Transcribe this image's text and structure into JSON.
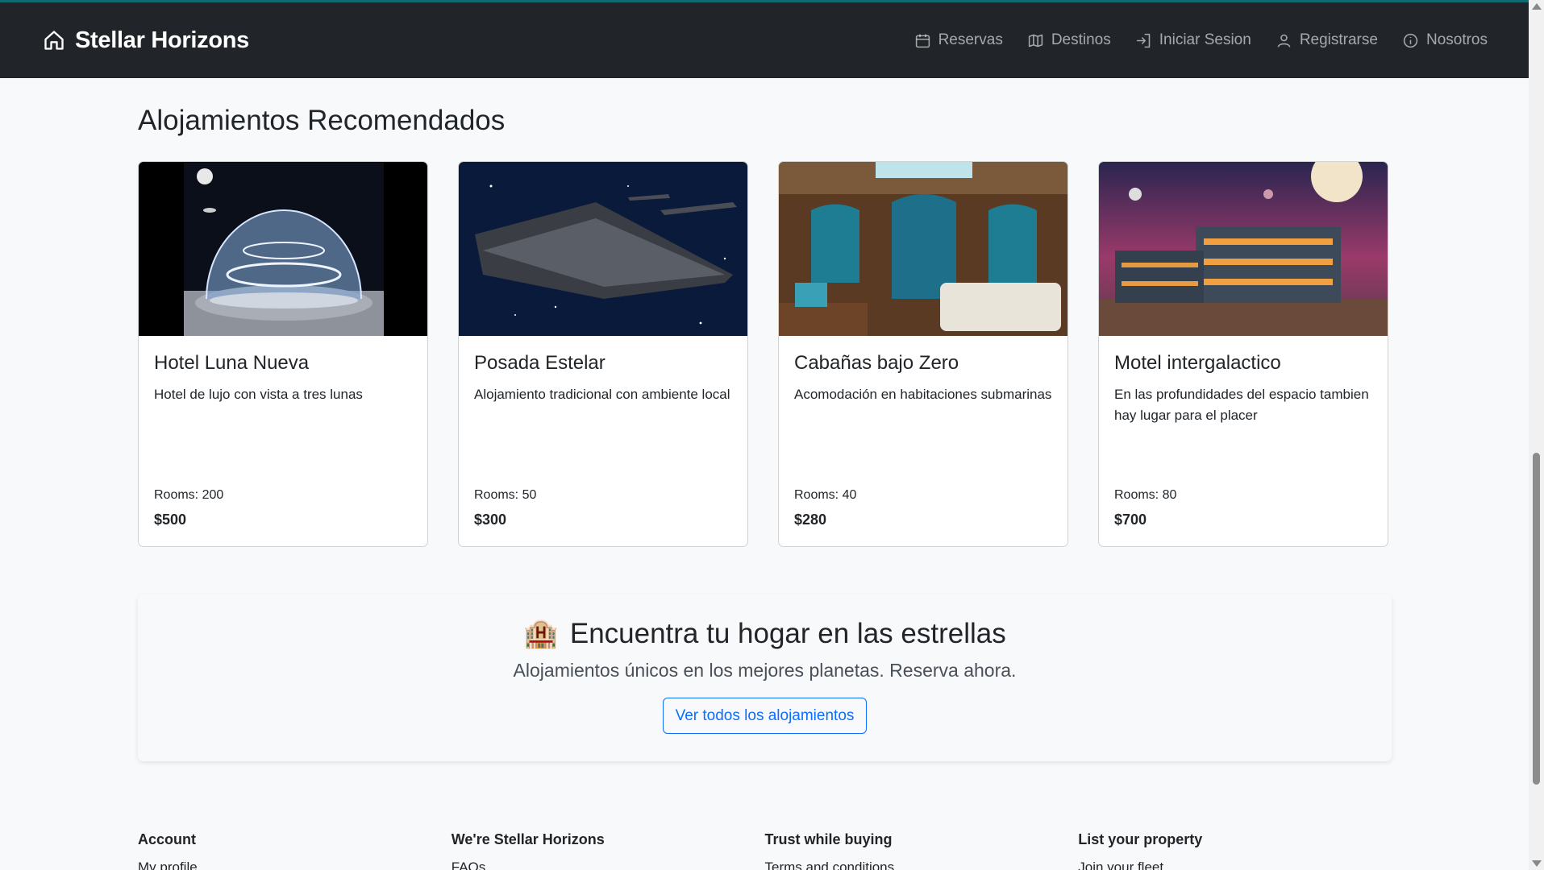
{
  "navbar": {
    "brand": "Stellar Horizons",
    "links": [
      {
        "label": "Reservas",
        "icon": "calendar-icon"
      },
      {
        "label": "Destinos",
        "icon": "map-icon"
      },
      {
        "label": "Iniciar Sesion",
        "icon": "login-icon"
      },
      {
        "label": "Registrarse",
        "icon": "user-icon"
      },
      {
        "label": "Nosotros",
        "icon": "info-icon"
      }
    ]
  },
  "section": {
    "title": "Alojamientos Recomendados"
  },
  "cards": [
    {
      "title": "Hotel Luna Nueva",
      "description": "Hotel de lujo con vista a tres lunas",
      "rooms": "Rooms: 200",
      "price": "$500",
      "image": "moon-dome-hotel"
    },
    {
      "title": "Posada Estelar",
      "description": "Alojamiento tradicional con ambiente local",
      "rooms": "Rooms: 50",
      "price": "$300",
      "image": "starship"
    },
    {
      "title": "Cabañas bajo Zero",
      "description": "Acomodación en habitaciones submarinas",
      "rooms": "Rooms: 40",
      "price": "$280",
      "image": "underwater-cabin"
    },
    {
      "title": "Motel intergalactico",
      "description": "En las profundidades del espacio tambien hay lugar para el placer",
      "rooms": "Rooms: 80",
      "price": "$700",
      "image": "night-motel"
    }
  ],
  "promo": {
    "emoji": "🏨",
    "title": "Encuentra tu hogar en las estrellas",
    "subtitle": "Alojamientos únicos en los mejores planetas. Reserva ahora.",
    "button": "Ver todos los alojamientos"
  },
  "footer": {
    "columns": [
      {
        "heading": "Account",
        "first_link": "My profile"
      },
      {
        "heading": "We're Stellar Horizons",
        "first_link": "FAQs"
      },
      {
        "heading": "Trust while buying",
        "first_link": "Terms and conditions"
      },
      {
        "heading": "List your property",
        "first_link": "Join your fleet"
      }
    ]
  },
  "colors": {
    "navbar": "#212529",
    "accent": "#0d6efd",
    "background": "#f8f9fa",
    "topline": "#0e6b72"
  }
}
